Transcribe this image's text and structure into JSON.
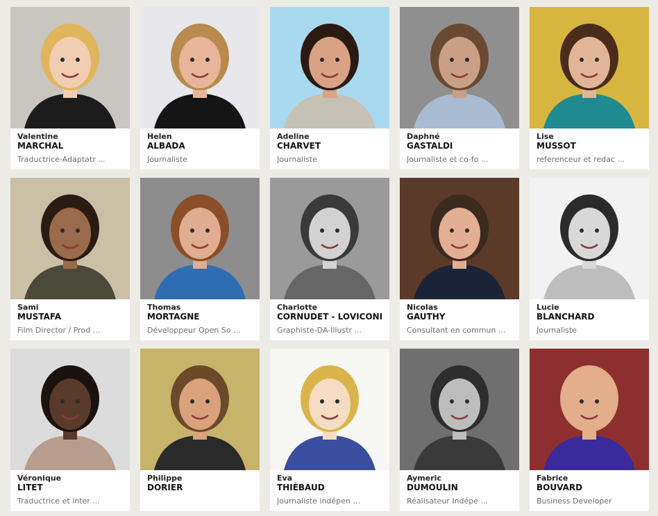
{
  "profiles": [
    {
      "first": "Valentine",
      "last": "MARCHAL",
      "role": "Traductrice-Adaptatr ...",
      "photo": "portrait-photo",
      "bg": "#c9c6c0",
      "skin": "#f1cdb2",
      "hair": "#e0b65c",
      "shirt": "#1c1c1c"
    },
    {
      "first": "Helen",
      "last": "ALBADA",
      "role": "Journaliste",
      "photo": "portrait-photo",
      "bg": "#e8e8ec",
      "skin": "#e9b59a",
      "hair": "#b98a4e",
      "shirt": "#151515"
    },
    {
      "first": "Adeline",
      "last": "CHARVET",
      "role": "Journaliste",
      "photo": "portrait-photo",
      "bg": "#a9d9ef",
      "skin": "#d9a285",
      "hair": "#2b1a12",
      "shirt": "#c7c0b4"
    },
    {
      "first": "Daphné",
      "last": "GASTALDI",
      "role": "Journaliste et co-fo ...",
      "photo": "portrait-photo",
      "bg": "#8f8f8f",
      "skin": "#c99f86",
      "hair": "#6a4a32",
      "shirt": "#a9bbd2"
    },
    {
      "first": "Lise",
      "last": "MUSSOT",
      "role": "referenceur et redac ...",
      "photo": "portrait-photo",
      "bg": "#d7b640",
      "skin": "#e3b598",
      "hair": "#4a2c1a",
      "shirt": "#1f8a8f"
    },
    {
      "first": "Sami",
      "last": "MUSTAFA",
      "role": "Film Director / Prod ...",
      "photo": "portrait-photo",
      "bg": "#cbbfa5",
      "skin": "#9a6a4c",
      "hair": "#2a1c12",
      "shirt": "#4b4a3a"
    },
    {
      "first": "Thomas",
      "last": "MORTAGNE",
      "role": "Développeur Open So ...",
      "photo": "portrait-photo",
      "bg": "#8d8d8d",
      "skin": "#e0ad90",
      "hair": "#8a4f28",
      "shirt": "#2f6db3"
    },
    {
      "first": "Charlotte",
      "last": "CORNUDET - LOVICONI",
      "role": "Graphiste-DA-Illustr ...",
      "photo": "portrait-photo",
      "bg": "#9a9a9a",
      "skin": "#d2d2d2",
      "hair": "#3a3a3a",
      "shirt": "#666666"
    },
    {
      "first": "Nicolas",
      "last": "GAUTHY",
      "role": "Consultant en commun ...",
      "photo": "portrait-photo",
      "bg": "#5b3a2a",
      "skin": "#e2ae94",
      "hair": "#3b2a1e",
      "shirt": "#1b2336"
    },
    {
      "first": "Lucie",
      "last": "BLANCHARD",
      "role": "Journaliste",
      "photo": "portrait-photo",
      "bg": "#f2f2f2",
      "skin": "#d8d8d8",
      "hair": "#2b2b2b",
      "shirt": "#bdbdbd"
    },
    {
      "first": "Véronique",
      "last": "LITET",
      "role": "Traductrice et inter ...",
      "photo": "portrait-photo",
      "bg": "#dcdcdc",
      "skin": "#5a3a2b",
      "hair": "#1a120e",
      "shirt": "#b89c8e"
    },
    {
      "first": "Philippe",
      "last": "DORIER",
      "role": "",
      "photo": "portrait-photo",
      "bg": "#c7b46a",
      "skin": "#d9a27c",
      "hair": "#6b4a2a",
      "shirt": "#2a2a2a"
    },
    {
      "first": "Eva",
      "last": "THIÉBAUD",
      "role": "Journaliste indépen ...",
      "photo": "portrait-illustration",
      "bg": "#f7f7f4",
      "skin": "#f6dcc2",
      "hair": "#d9b44a",
      "shirt": "#3b4fa0"
    },
    {
      "first": "Aymeric",
      "last": "DUMOULIN",
      "role": "Réalisateur Indépe ...",
      "photo": "portrait-photo",
      "bg": "#6f6f6f",
      "skin": "#bdbdbd",
      "hair": "#2e2e2e",
      "shirt": "#3a3a3a"
    },
    {
      "first": "Fabrice",
      "last": "BOUVARD",
      "role": "Business Developer",
      "photo": "portrait-photo",
      "bg": "#8e2f2f",
      "skin": "#e4ad8c",
      "hair": "#e4ad8c",
      "shirt": "#3a2a9a"
    }
  ]
}
